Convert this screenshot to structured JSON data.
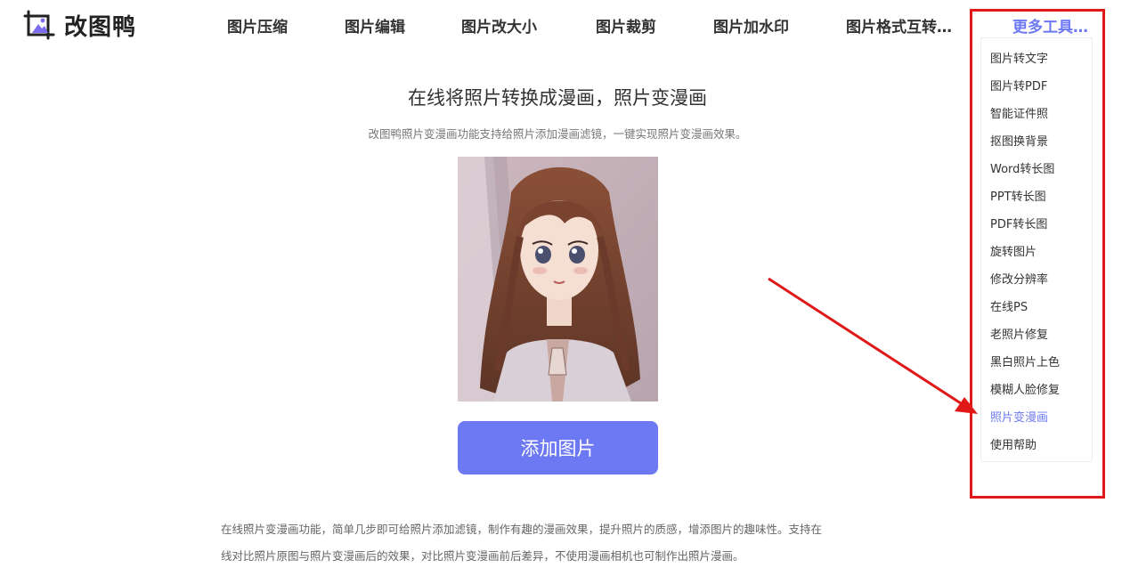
{
  "brand": {
    "name": "改图鸭"
  },
  "nav": {
    "items": [
      {
        "label": "图片压缩"
      },
      {
        "label": "图片编辑"
      },
      {
        "label": "图片改大小"
      },
      {
        "label": "图片裁剪"
      },
      {
        "label": "图片加水印"
      },
      {
        "label": "图片格式互转…"
      }
    ],
    "more_label": "更多工具…"
  },
  "dropdown": {
    "items": [
      {
        "label": "图片转文字"
      },
      {
        "label": "图片转PDF"
      },
      {
        "label": "智能证件照"
      },
      {
        "label": "抠图换背景"
      },
      {
        "label": "Word转长图"
      },
      {
        "label": "PPT转长图"
      },
      {
        "label": "PDF转长图"
      },
      {
        "label": "旋转图片"
      },
      {
        "label": "修改分辨率"
      },
      {
        "label": "在线PS"
      },
      {
        "label": "老照片修复"
      },
      {
        "label": "黑白照片上色"
      },
      {
        "label": "模糊人脸修复"
      },
      {
        "label": "照片变漫画"
      },
      {
        "label": "使用帮助"
      }
    ],
    "active_label": "照片变漫画"
  },
  "main": {
    "title": "在线将照片转换成漫画，照片变漫画",
    "subtitle": "改图鸭照片变漫画功能支持给照片添加漫画滤镜，一键实现照片变漫画效果。",
    "add_button": "添加图片",
    "description_line1": "在线照片变漫画功能，简单几步即可给照片添加滤镜，制作有趣的漫画效果，提升照片的质感，增添图片的趣味性。支持在",
    "description_line2": "线对比照片原图与照片变漫画后的效果，对比照片变漫画前后差异，不使用漫画相机也可制作出照片漫画。"
  },
  "colors": {
    "accent": "#6d79f2",
    "annotation_red": "#e01818",
    "text_dark": "#333333",
    "text_muted": "#777777"
  },
  "icons": {
    "logo": "image-frame-icon",
    "preview": "anime-girl-illustration"
  }
}
